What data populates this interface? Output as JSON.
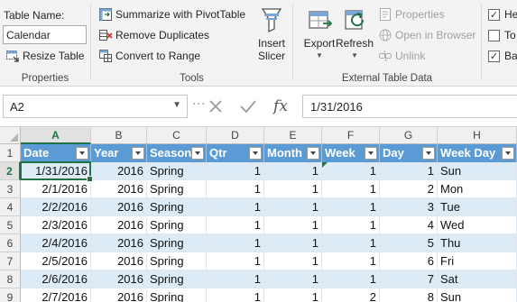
{
  "ribbon": {
    "properties": {
      "table_name_label": "Table Name:",
      "table_name_value": "Calendar",
      "resize_table": "Resize Table",
      "group_label": "Properties"
    },
    "tools": {
      "summarize": "Summarize with PivotTable",
      "remove_duplicates": "Remove Duplicates",
      "convert_to_range": "Convert to Range",
      "insert_slicer_line1": "Insert",
      "insert_slicer_line2": "Slicer",
      "group_label": "Tools"
    },
    "external": {
      "export": "Export",
      "refresh": "Refresh",
      "properties": "Properties",
      "open_in_browser": "Open in Browser",
      "unlink": "Unlink",
      "group_label": "External Table Data"
    },
    "style_options": {
      "header_row": "He",
      "total_row": "To",
      "banded_rows": "Ba",
      "header_row_checked": "✓",
      "total_row_checked": "",
      "banded_rows_checked": "✓"
    }
  },
  "formula_bar": {
    "name_box": "A2",
    "formula": "1/31/2016",
    "cancel_icon": "cancel-x-icon",
    "enter_icon": "enter-check-icon",
    "fx_label": "fx"
  },
  "grid": {
    "columns": [
      "A",
      "B",
      "C",
      "D",
      "E",
      "F",
      "G",
      "H"
    ],
    "row_numbers": [
      "1",
      "2",
      "3",
      "4",
      "5",
      "6",
      "7",
      "8",
      "9"
    ],
    "headers": [
      "Date",
      "Year",
      "Season",
      "Qtr",
      "Month",
      "Week",
      "Day",
      "Week Day"
    ],
    "rows": [
      [
        "1/31/2016",
        "2016",
        "Spring",
        "1",
        "1",
        "1",
        "1",
        "Sun"
      ],
      [
        "2/1/2016",
        "2016",
        "Spring",
        "1",
        "1",
        "1",
        "2",
        "Mon"
      ],
      [
        "2/2/2016",
        "2016",
        "Spring",
        "1",
        "1",
        "1",
        "3",
        "Tue"
      ],
      [
        "2/3/2016",
        "2016",
        "Spring",
        "1",
        "1",
        "1",
        "4",
        "Wed"
      ],
      [
        "2/4/2016",
        "2016",
        "Spring",
        "1",
        "1",
        "1",
        "5",
        "Thu"
      ],
      [
        "2/5/2016",
        "2016",
        "Spring",
        "1",
        "1",
        "1",
        "6",
        "Fri"
      ],
      [
        "2/6/2016",
        "2016",
        "Spring",
        "1",
        "1",
        "1",
        "7",
        "Sat"
      ],
      [
        "2/7/2016",
        "2016",
        "Spring",
        "1",
        "1",
        "2",
        "8",
        "Sun"
      ]
    ],
    "selected_cell": "A2"
  },
  "colors": {
    "table_header": "#5b9bd5",
    "band": "#ddebf7",
    "selection": "#217346",
    "ribbon_bg": "#f3f3f3"
  }
}
